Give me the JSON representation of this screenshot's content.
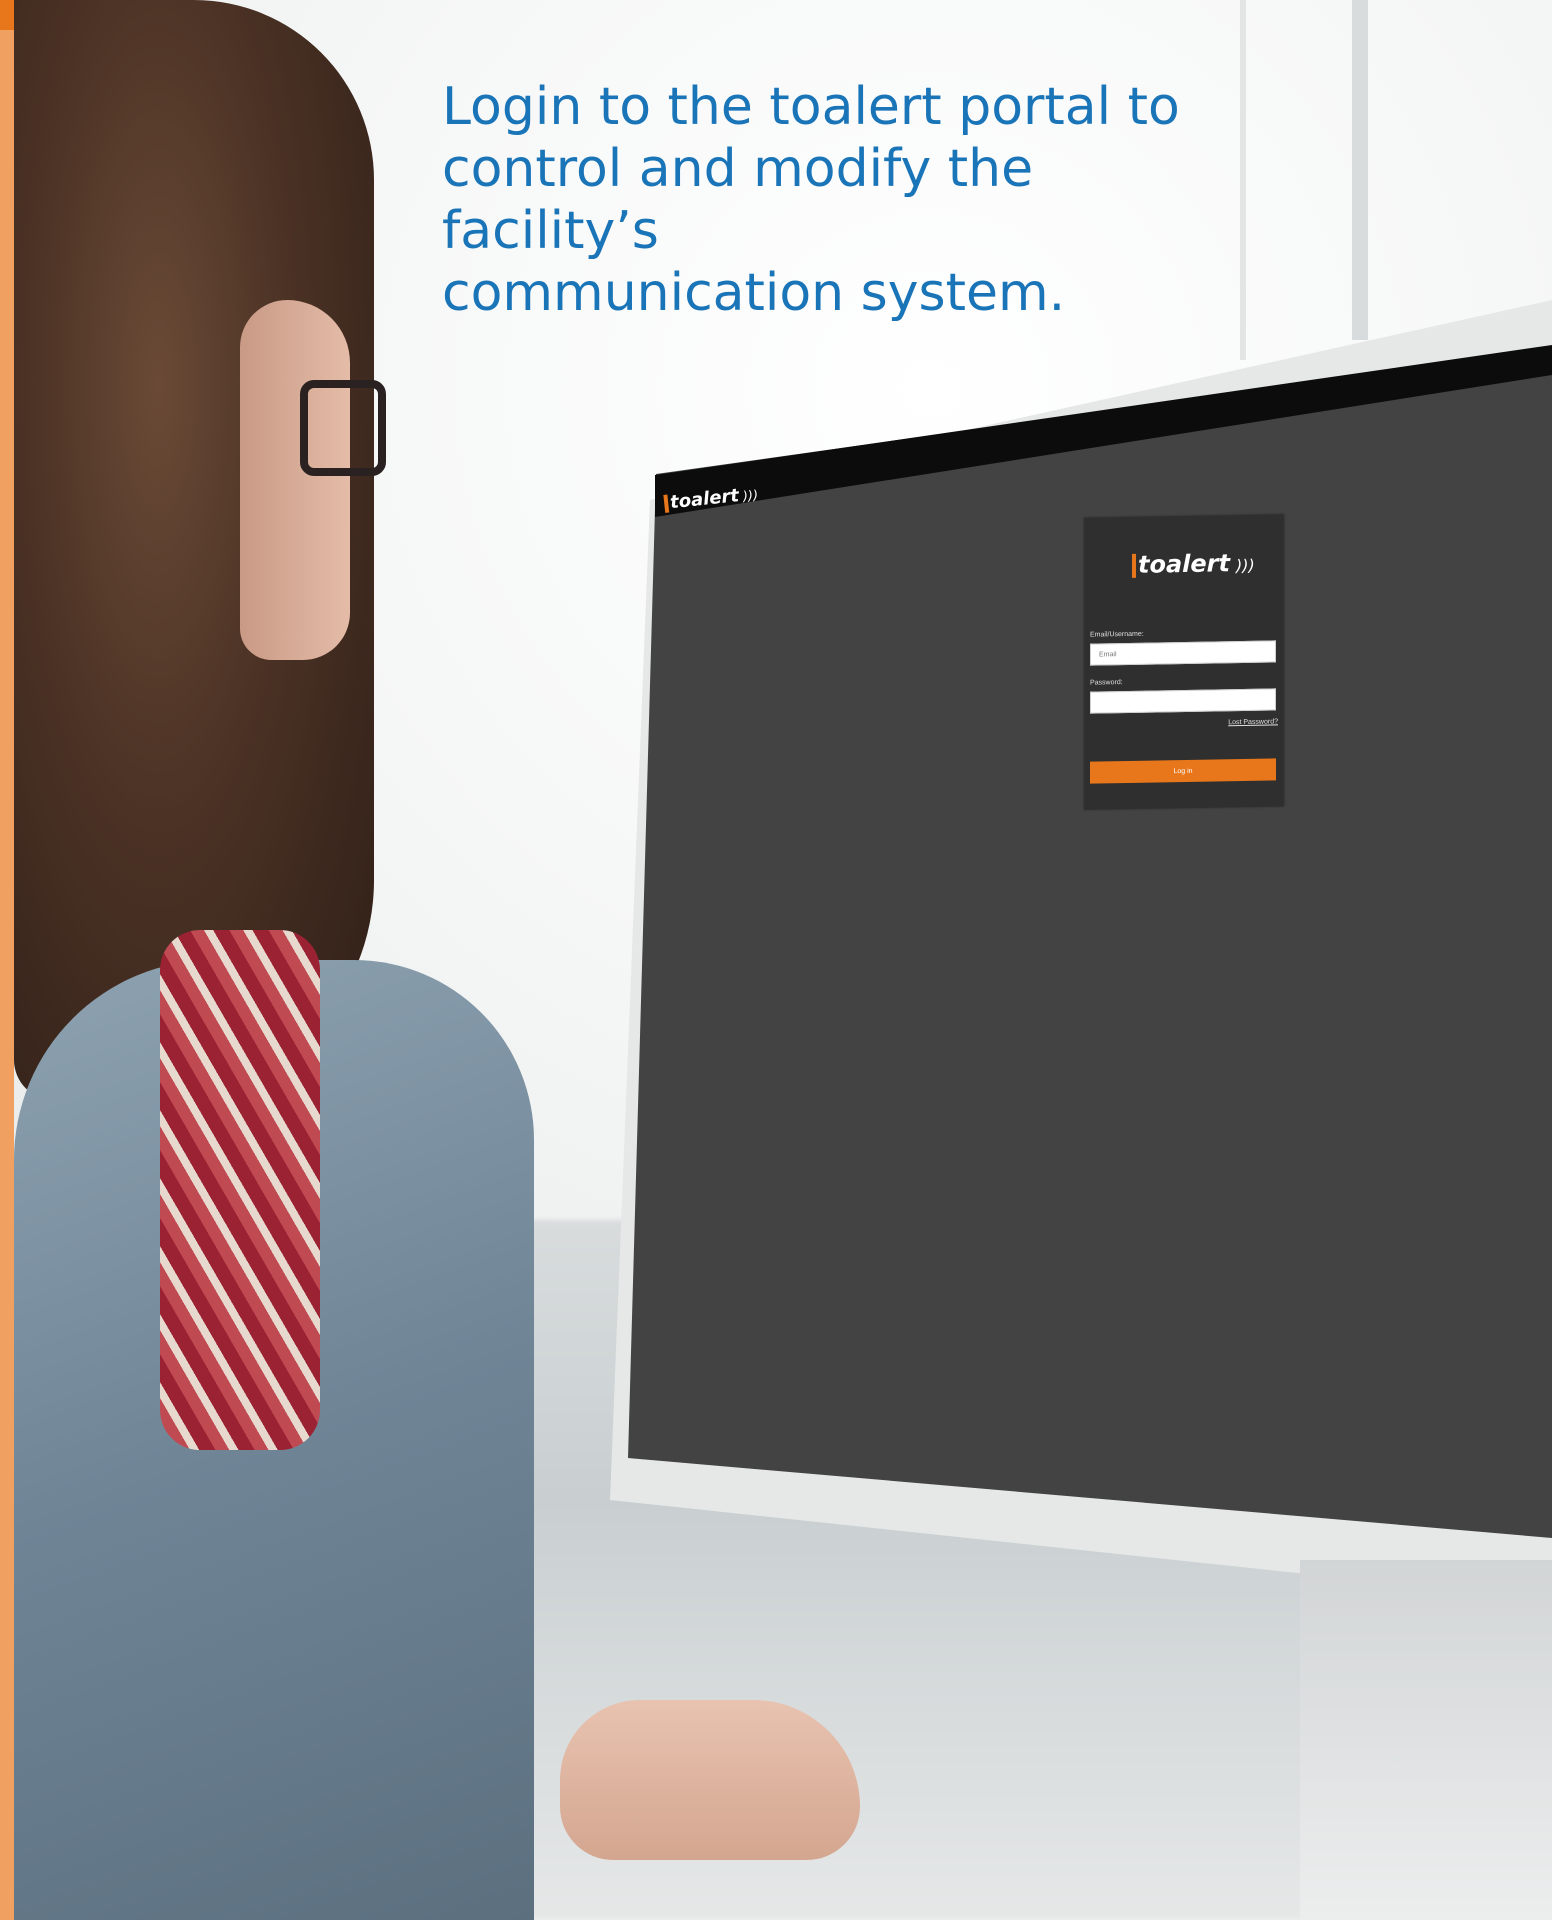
{
  "headline": {
    "line1": "Login to the toalert portal to",
    "line2": "control and modify the facility’s",
    "line3": "communication system."
  },
  "app_header": {
    "logo_text": "toalert"
  },
  "login_form": {
    "logo_text": "toalert",
    "email_label": "Email/Username:",
    "email_placeholder": "Email",
    "password_label": "Password:",
    "lost_password_link": "Lost Password?",
    "login_button": "Log in"
  },
  "colors": {
    "accent": "#e8761b",
    "headline": "#1a74b8",
    "screen_bg": "#434343",
    "card_bg": "#2f2f2f"
  }
}
